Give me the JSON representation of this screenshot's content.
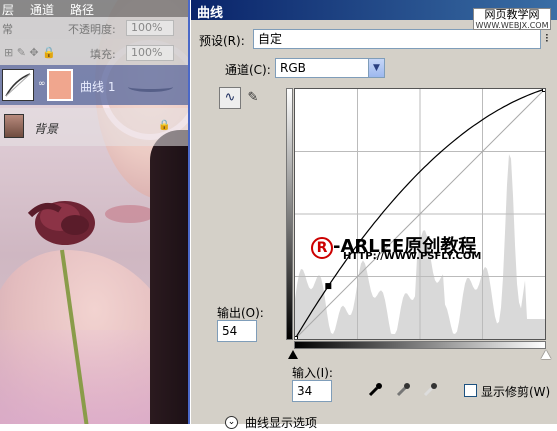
{
  "layers_panel": {
    "tabs": [
      "层",
      "通道",
      "路径"
    ],
    "mode_label": "常",
    "opacity_label": "不透明度:",
    "opacity_value": "100%",
    "fill_label": "填充:",
    "fill_value": "100%",
    "layers": [
      {
        "name": "曲线 1",
        "type": "adjustment"
      },
      {
        "name": "背景",
        "type": "background"
      }
    ]
  },
  "dialog": {
    "title": "曲线",
    "watermark_line1": "网页教学网",
    "watermark_line2": "WWW.WEBJX.COM",
    "preset_label": "预设(R):",
    "preset_value": "自定",
    "channel_label": "通道(C):",
    "channel_value": "RGB",
    "output_label": "输出(O):",
    "output_value": "54",
    "input_label": "输入(I):",
    "input_value": "34",
    "show_clipping_label": "显示修剪(W)",
    "curve_options_label": "曲线显示选项",
    "graph_watermark_text": "-ARLEE原创教程",
    "graph_watermark_mark": "R",
    "graph_watermark_url": "HTTP://WWW.PSFLY.COM",
    "icons": {
      "curve_tool": "curve-point-icon",
      "pencil_tool": "pencil-icon",
      "black_eyedropper": "eyedropper-black-icon",
      "gray_eyedropper": "eyedropper-gray-icon",
      "white_eyedropper": "eyedropper-white-icon"
    }
  },
  "chart_data": {
    "type": "line",
    "xlim": [
      0,
      255
    ],
    "ylim": [
      0,
      255
    ],
    "curve_points": [
      [
        0,
        0
      ],
      [
        34,
        54
      ],
      [
        255,
        255
      ]
    ],
    "grid": true
  }
}
